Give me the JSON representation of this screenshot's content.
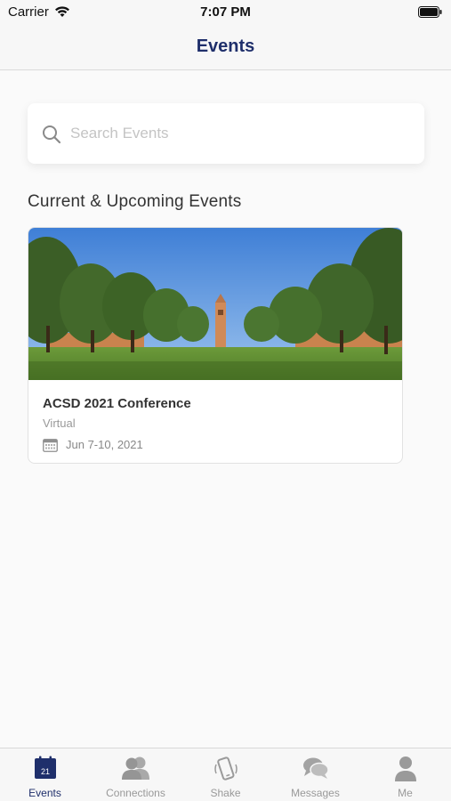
{
  "status_bar": {
    "carrier": "Carrier",
    "time": "7:07 PM"
  },
  "nav": {
    "title": "Events"
  },
  "search": {
    "placeholder": "Search Events",
    "value": ""
  },
  "section": {
    "title": "Current & Upcoming Events"
  },
  "events": [
    {
      "name": "ACSD 2021 Conference",
      "location": "Virtual",
      "date": "Jun 7-10, 2021"
    }
  ],
  "tab_bar": {
    "tabs": [
      {
        "label": "Events",
        "icon": "calendar-icon",
        "badge": "21",
        "active": true
      },
      {
        "label": "Connections",
        "icon": "people-icon",
        "active": false
      },
      {
        "label": "Shake",
        "icon": "shake-phone-icon",
        "active": false
      },
      {
        "label": "Messages",
        "icon": "chat-bubbles-icon",
        "active": false
      },
      {
        "label": "Me",
        "icon": "person-icon",
        "active": false
      }
    ]
  },
  "colors": {
    "brand": "#1f2f6b",
    "inactive": "#9a9a9a",
    "background": "#fafafa"
  }
}
